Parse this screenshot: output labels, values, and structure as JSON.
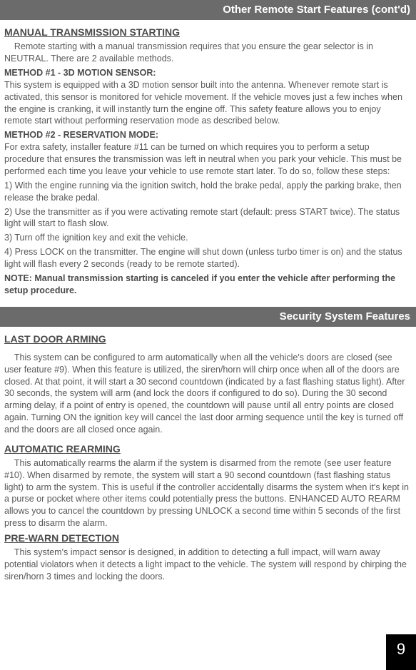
{
  "bar1": "Other Remote Start Features (cont'd)",
  "h_manual": "MANUAL TRANSMISSION STARTING",
  "p_manual_intro": "Remote starting with a manual transmission requires that you ensure the gear selector is in NEUTRAL. There are 2 available methods.",
  "h_method1": "METHOD #1 - 3D MOTION SENSOR:",
  "p_method1": "This system is equipped with a 3D motion sensor built into the antenna. Whenever remote start is activated, this sensor is monitored for vehicle movement. If the vehicle moves just a few inches when the engine is cranking, it will instantly turn the engine off. This safety feature allows you to enjoy remote start without performing reservation mode as described below.",
  "h_method2": "METHOD #2 - RESERVATION MODE:",
  "p_method2_intro": "For extra safety, installer feature #11 can be turned on which requires you to perform a setup procedure that ensures the transmission was left in neutral when you park your vehicle. This must be performed each time you leave your vehicle to use remote start later. To do so, follow these steps:",
  "step1": "1) With the engine running via the ignition switch, hold the brake pedal, apply the parking brake, then release the brake pedal.",
  "step2": "2) Use the transmitter as if you were activating remote start (default: press START twice). The status light will start to flash slow.",
  "step3": "3) Turn off the ignition key and exit the vehicle.",
  "step4": "4) Press LOCK on the transmitter. The engine will shut down (unless turbo timer is on) and the status light will flash every 2 seconds (ready to be remote started).",
  "note_manual": "NOTE: Manual transmission starting is canceled if you enter the vehicle after performing the setup procedure.",
  "bar2": "Security System Features",
  "h_lastdoor": "LAST DOOR ARMING",
  "p_lastdoor": "This system can be configured to arm automatically when all the vehicle's doors are closed (see user feature #9). When this feature is utilized, the siren/horn will chirp once when all of the doors are closed. At that point, it will start a 30 second countdown (indicated by a fast flashing status light). After 30 seconds, the system will arm (and lock the doors if configured to do so). During the 30 second arming delay, if a point of entry is opened, the countdown will pause until all entry points are closed again. Turning ON the ignition key will cancel the last door arming sequence until the key is turned off and the doors are all closed once again.",
  "h_autorearm": "AUTOMATIC REARMING",
  "p_autorearm": "This automatically rearms  the alarm if the system is disarmed from the remote (see user feature #10). When disarmed by remote, the system will start a 90 second countdown (fast flashing status light) to arm the system. This is useful if the controller accidentally disarms the system when it's kept in a purse or pocket where other items could potentially press the buttons.  ENHANCED AUTO REARM allows you to cancel the countdown by pressing UNLOCK a second time within 5 seconds of the first press to disarm the alarm.",
  "h_prewarn": "PRE-WARN DETECTION",
  "p_prewarn": "This system's impact sensor is designed, in addition to detecting a full impact, will warn away potential violators when it detects a light impact to the vehicle. The system will respond by chirping the siren/horn 3 times and locking the doors.",
  "page_number": "9"
}
